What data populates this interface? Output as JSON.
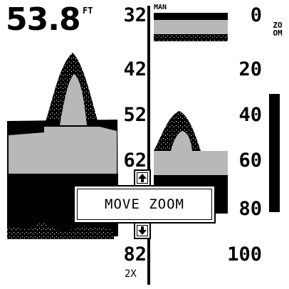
{
  "depth": {
    "value": "53.8",
    "unit": "FT"
  },
  "left_scale": {
    "labels": [
      "32",
      "42",
      "52",
      "62",
      "82"
    ],
    "zoom_factor": "2X"
  },
  "zoom_panel": {
    "mode": "MAN"
  },
  "right_scale": {
    "labels": [
      "0",
      "20",
      "40",
      "60",
      "80",
      "100"
    ],
    "title": "ZOOM"
  },
  "zoom_range": {
    "from": 32,
    "to": 82
  },
  "dialog": {
    "text": "MOVE ZOOM",
    "up_icon": "arrow-up-icon",
    "down_icon": "arrow-down-icon"
  },
  "colors": {
    "ink": "#000000",
    "grey": "#b8b8b8",
    "background": "#ffffff"
  }
}
